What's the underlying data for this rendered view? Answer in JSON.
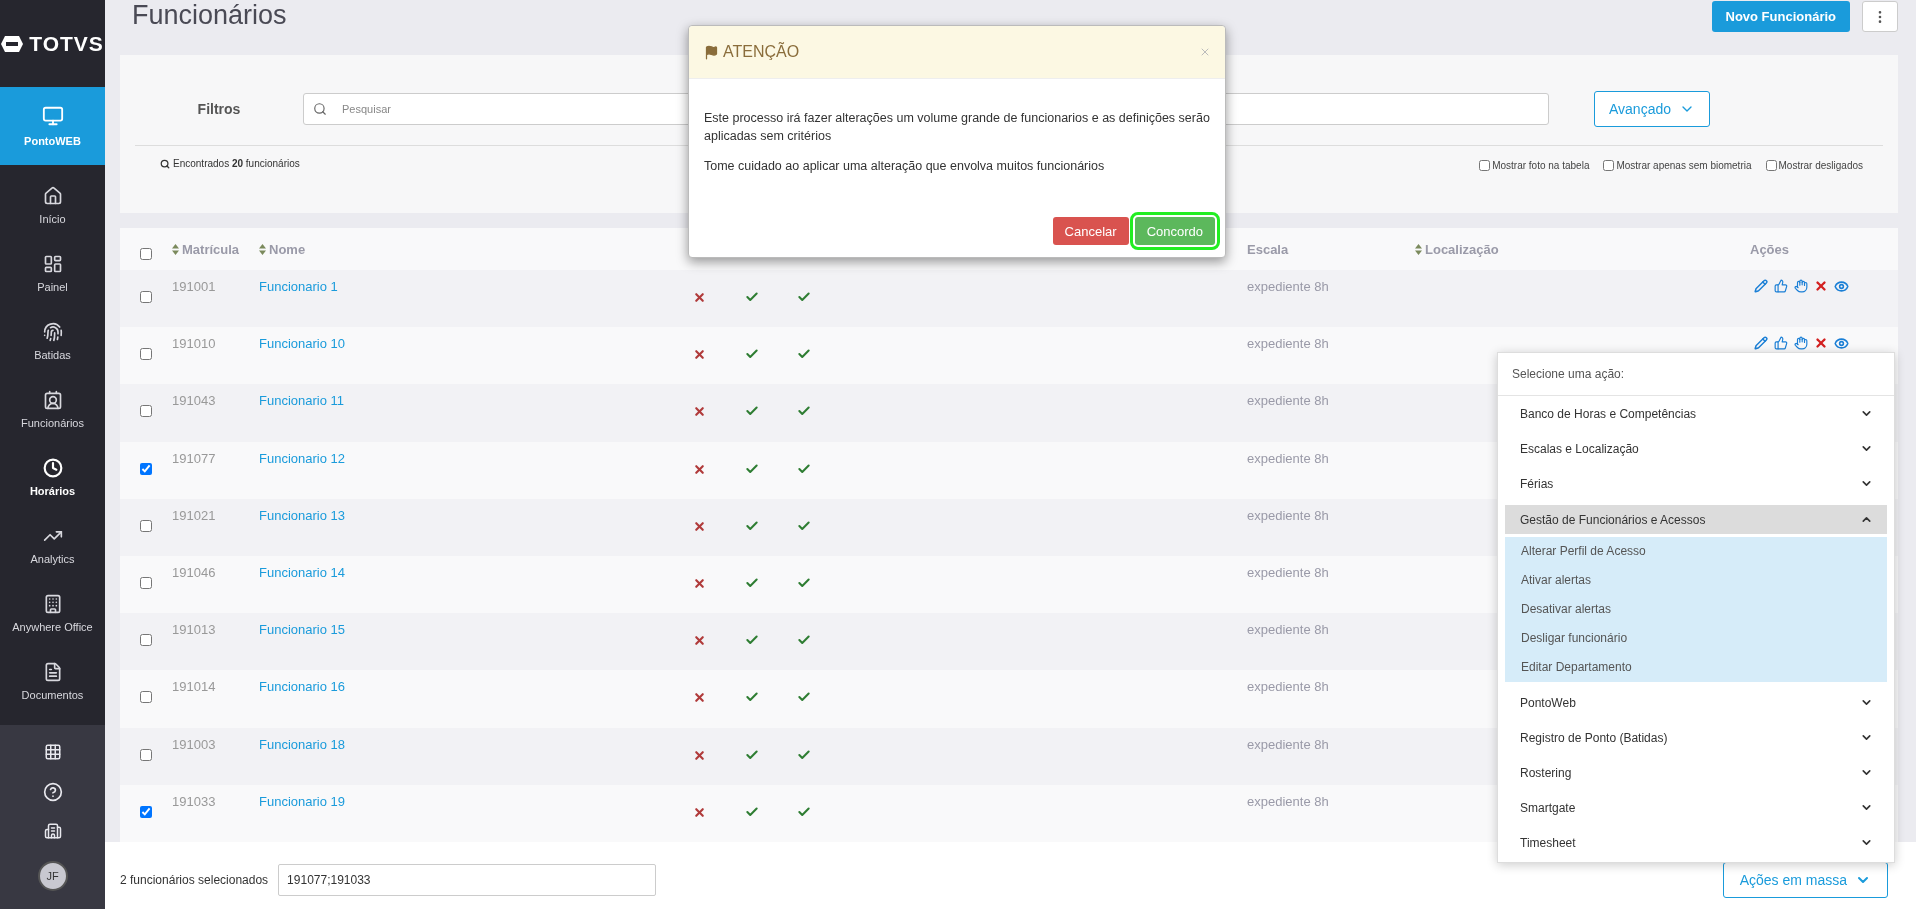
{
  "sidebar": {
    "logo": "TOTVS",
    "module": {
      "label": "PontoWEB"
    },
    "items": [
      {
        "label": "Início",
        "selected": false
      },
      {
        "label": "Painel",
        "selected": false
      },
      {
        "label": "Batidas",
        "selected": false
      },
      {
        "label": "Funcionários",
        "selected": false
      },
      {
        "label": "Horários",
        "selected": true
      },
      {
        "label": "Analytics",
        "selected": false
      },
      {
        "label": "Anywhere Office",
        "selected": false
      },
      {
        "label": "Documentos",
        "selected": false
      }
    ],
    "user_initials": "JF"
  },
  "page": {
    "title": "Funcionários",
    "primary_button": "Novo Funcionário"
  },
  "filters": {
    "label": "Filtros",
    "search": {
      "placeholder": "Pesquisar"
    },
    "advanced_button": "Avançado",
    "found": "Encontrados **20** funcionários",
    "options": [
      {
        "label": "Mostrar foto na tabela",
        "checked": false
      },
      {
        "label": "Mostrar apenas sem biometria",
        "checked": false
      },
      {
        "label": "Mostrar desligados",
        "checked": false
      }
    ]
  },
  "table": {
    "select_all": false,
    "columns": [
      {
        "label": "Matrícula",
        "sortable": true
      },
      {
        "label": "Nome",
        "sortable": true
      },
      {
        "label": "Escala",
        "sortable": false
      },
      {
        "label": "Localização",
        "sortable": true
      },
      {
        "label": "Ações",
        "sortable": false
      }
    ],
    "rows": [
      {
        "selected": false,
        "matricula": "191001",
        "nome": "Funcionario 1",
        "flags": [
          false,
          true,
          true
        ],
        "escala": "expediente 8h"
      },
      {
        "selected": false,
        "matricula": "191010",
        "nome": "Funcionario 10",
        "flags": [
          false,
          true,
          true
        ],
        "escala": "expediente 8h"
      },
      {
        "selected": false,
        "matricula": "191043",
        "nome": "Funcionario 11",
        "flags": [
          false,
          true,
          true
        ],
        "escala": "expediente 8h"
      },
      {
        "selected": true,
        "matricula": "191077",
        "nome": "Funcionario 12",
        "flags": [
          false,
          true,
          true
        ],
        "escala": "expediente 8h"
      },
      {
        "selected": false,
        "matricula": "191021",
        "nome": "Funcionario 13",
        "flags": [
          false,
          true,
          true
        ],
        "escala": "expediente 8h"
      },
      {
        "selected": false,
        "matricula": "191046",
        "nome": "Funcionario 14",
        "flags": [
          false,
          true,
          true
        ],
        "escala": "expediente 8h"
      },
      {
        "selected": false,
        "matricula": "191013",
        "nome": "Funcionario 15",
        "flags": [
          false,
          true,
          true
        ],
        "escala": "expediente 8h"
      },
      {
        "selected": false,
        "matricula": "191014",
        "nome": "Funcionario 16",
        "flags": [
          false,
          true,
          true
        ],
        "escala": "expediente 8h"
      },
      {
        "selected": false,
        "matricula": "191003",
        "nome": "Funcionario 18",
        "flags": [
          false,
          true,
          true
        ],
        "escala": "expediente 8h"
      },
      {
        "selected": true,
        "matricula": "191033",
        "nome": "Funcionario 19",
        "flags": [
          false,
          true,
          true
        ],
        "escala": "expediente 8h"
      }
    ]
  },
  "footer": {
    "selection_text": "2 funcionários selecionados",
    "selection_value": "191077;191033",
    "mass_action_button": "Ações em massa"
  },
  "action_menu": {
    "title": "Selecione uma ação:",
    "groups": [
      {
        "label": "Banco de Horas e Competências",
        "expanded": false
      },
      {
        "label": "Escalas e Localização",
        "expanded": false
      },
      {
        "label": "Férias",
        "expanded": false
      },
      {
        "label": "Gestão de Funcionários e Acessos",
        "expanded": true,
        "children": [
          {
            "label": "Alterar Perfil de Acesso"
          },
          {
            "label": "Ativar alertas"
          },
          {
            "label": "Desativar alertas"
          },
          {
            "label": "Desligar funcionário"
          },
          {
            "label": "Editar Departamento"
          }
        ]
      },
      {
        "label": "PontoWeb",
        "expanded": false
      },
      {
        "label": "Registro de Ponto (Batidas)",
        "expanded": false
      },
      {
        "label": "Rostering",
        "expanded": false
      },
      {
        "label": "Smartgate",
        "expanded": false
      },
      {
        "label": "Timesheet",
        "expanded": false
      }
    ]
  },
  "dialog": {
    "title": "ATENÇÃO",
    "paragraphs": [
      "Este processo irá fazer alterações um volume grande de funcionarios e as definições serão aplicadas sem critérios",
      "Tome cuidado ao aplicar uma alteração que envolva muitos funcionários"
    ],
    "buttons": [
      {
        "label": "Cancelar",
        "kind": "danger",
        "highlighted": false
      },
      {
        "label": "Concordo",
        "kind": "success",
        "highlighted": true
      }
    ]
  }
}
